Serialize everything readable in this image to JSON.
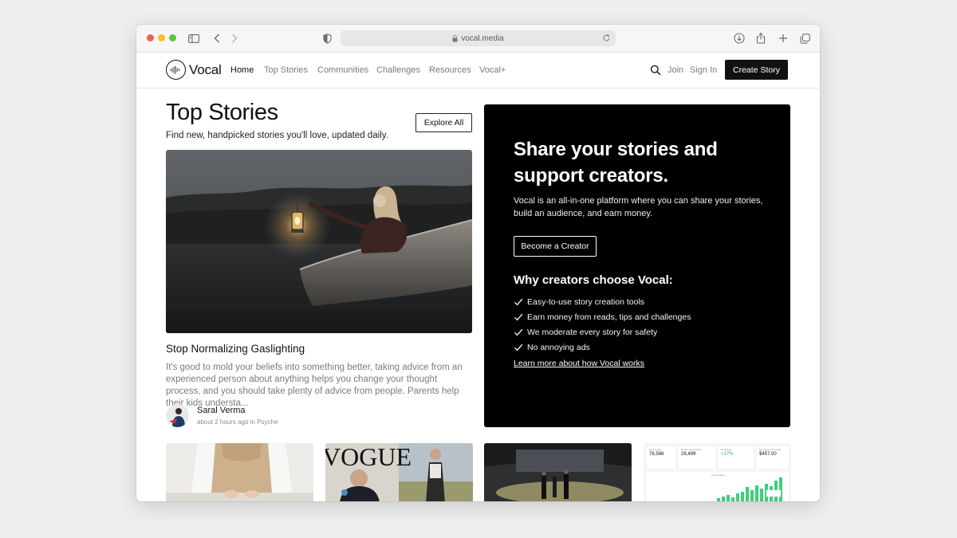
{
  "browser": {
    "url": "vocal.media"
  },
  "nav": {
    "logo_text": "Vocal",
    "links": [
      "Home",
      "Top Stories",
      "Communities",
      "Challenges",
      "Resources",
      "Vocal+"
    ],
    "join": "Join",
    "sign_in": "Sign In",
    "create_story": "Create Story"
  },
  "top_stories": {
    "title": "Top Stories",
    "subtitle": "Find new, handpicked stories you'll love, updated daily.",
    "explore_all": "Explore All"
  },
  "featured": {
    "title": "Stop Normalizing Gaslighting",
    "excerpt": "It's good to mold your beliefs into something better, taking advice from an experienced person about anything helps you change your thought process, and you should take plenty of advice from people. Parents help their kids understa...",
    "author": "Saral Verma",
    "meta": "about 2 hours ago in Psyche"
  },
  "promo": {
    "title": "Share your stories and support creators.",
    "description": "Vocal is an all-in-one platform where you can share your stories, build an audience, and earn money.",
    "cta": "Become a Creator",
    "why_title": "Why creators choose Vocal:",
    "benefits": [
      "Easy-to-use story creation tools",
      "Earn money from reads, tips and challenges",
      "We moderate every story for safety",
      "No annoying ads"
    ],
    "learn_more": "Learn more about how Vocal works"
  },
  "cards": {
    "dashboard": {
      "stats": [
        {
          "label": "Total reads",
          "value": "76,586"
        },
        {
          "label": "Reads last 30 days",
          "value": "28,499"
        },
        {
          "label": "% change",
          "value": "+17%"
        },
        {
          "label": "Earnings from reads",
          "value": "$457.00"
        }
      ],
      "chart_caption": "Last 30 days"
    },
    "vogue_text": "VOGUE"
  },
  "colors": {
    "primary": "#111111",
    "promo_bg": "#000000",
    "nav_muted": "#7a7a7a",
    "positive": "#2fbf6a",
    "chart_bar": "#3ecf7a"
  }
}
